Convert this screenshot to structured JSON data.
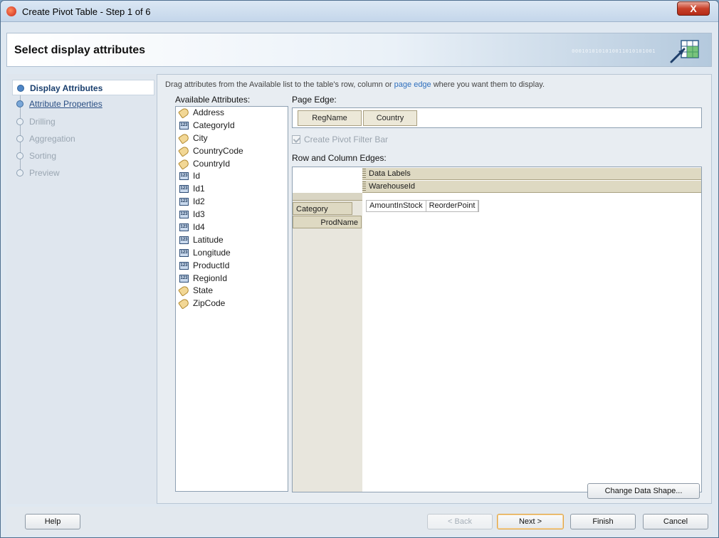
{
  "window": {
    "title": "Create Pivot Table - Step 1 of 6",
    "close_glyph": "X"
  },
  "header": {
    "title": "Select display attributes",
    "watermark": "0001010101010011010101001"
  },
  "nav": {
    "steps": [
      {
        "label": "Display Attributes",
        "state": "active"
      },
      {
        "label": "Attribute Properties",
        "state": "link"
      },
      {
        "label": "Drilling",
        "state": "disabled"
      },
      {
        "label": "Aggregation",
        "state": "disabled"
      },
      {
        "label": "Sorting",
        "state": "disabled"
      },
      {
        "label": "Preview",
        "state": "disabled"
      }
    ]
  },
  "main": {
    "instructions_pre": "Drag attributes from the Available list to the table's row, column or ",
    "instructions_link": "page edge",
    "instructions_post": " where you want them to display.",
    "available_label": "Available Attributes:",
    "page_edge_label": "Page Edge:",
    "row_col_label": "Row and Column Edges:",
    "pivot_filter_label": "Create Pivot Filter Bar",
    "pivot_filter_checked": true,
    "available_attributes": [
      {
        "name": "Address",
        "type": "text"
      },
      {
        "name": "CategoryId",
        "type": "number"
      },
      {
        "name": "City",
        "type": "text"
      },
      {
        "name": "CountryCode",
        "type": "text"
      },
      {
        "name": "CountryId",
        "type": "text"
      },
      {
        "name": "Id",
        "type": "number"
      },
      {
        "name": "Id1",
        "type": "number"
      },
      {
        "name": "Id2",
        "type": "number"
      },
      {
        "name": "Id3",
        "type": "number"
      },
      {
        "name": "Id4",
        "type": "number"
      },
      {
        "name": "Latitude",
        "type": "number"
      },
      {
        "name": "Longitude",
        "type": "number"
      },
      {
        "name": "ProductId",
        "type": "number"
      },
      {
        "name": "RegionId",
        "type": "number"
      },
      {
        "name": "State",
        "type": "text"
      },
      {
        "name": "ZipCode",
        "type": "text"
      }
    ],
    "page_edge_items": [
      "RegName",
      "Country"
    ],
    "column_edges": [
      "Data Labels",
      "WarehouseId"
    ],
    "row_edges": [
      "Category",
      "ProdName"
    ],
    "data_labels": [
      "AmountInStock",
      "ReorderPoint"
    ]
  },
  "buttons": {
    "change_shape": "Change Data Shape...",
    "help": "Help",
    "back": "< Back",
    "next": "Next >",
    "finish": "Finish",
    "cancel": "Cancel"
  }
}
